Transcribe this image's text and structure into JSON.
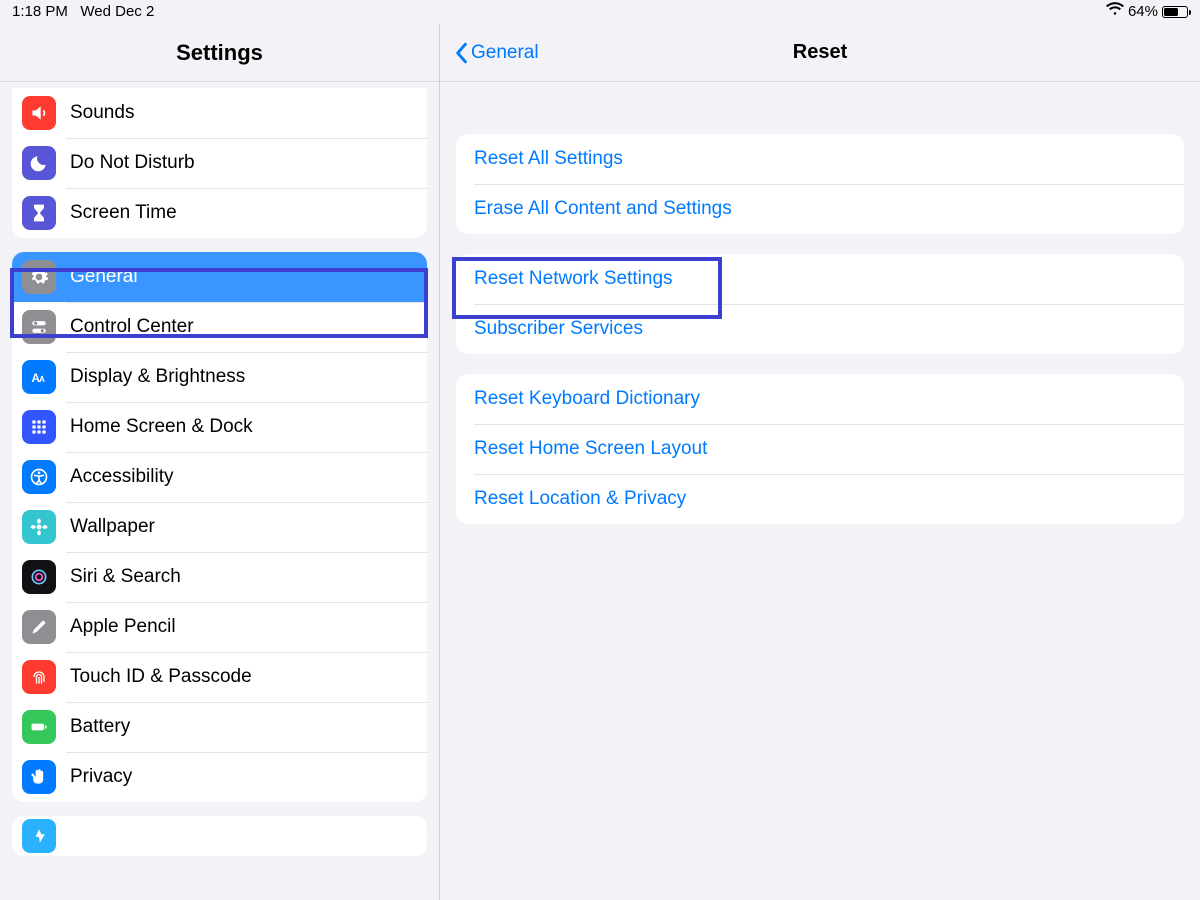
{
  "status": {
    "time": "1:18 PM",
    "date": "Wed Dec 2",
    "battery_pct": "64%"
  },
  "sidebar": {
    "title": "Settings",
    "items": [
      {
        "label": "Sounds"
      },
      {
        "label": "Do Not Disturb"
      },
      {
        "label": "Screen Time"
      },
      {
        "label": "General"
      },
      {
        "label": "Control Center"
      },
      {
        "label": "Display & Brightness"
      },
      {
        "label": "Home Screen & Dock"
      },
      {
        "label": "Accessibility"
      },
      {
        "label": "Wallpaper"
      },
      {
        "label": "Siri & Search"
      },
      {
        "label": "Apple Pencil"
      },
      {
        "label": "Touch ID & Passcode"
      },
      {
        "label": "Battery"
      },
      {
        "label": "Privacy"
      }
    ]
  },
  "detail": {
    "back_label": "General",
    "title": "Reset",
    "groups": [
      [
        "Reset All Settings",
        "Erase All Content and Settings"
      ],
      [
        "Reset Network Settings",
        "Subscriber Services"
      ],
      [
        "Reset Keyboard Dictionary",
        "Reset Home Screen Layout",
        "Reset Location & Privacy"
      ]
    ]
  }
}
